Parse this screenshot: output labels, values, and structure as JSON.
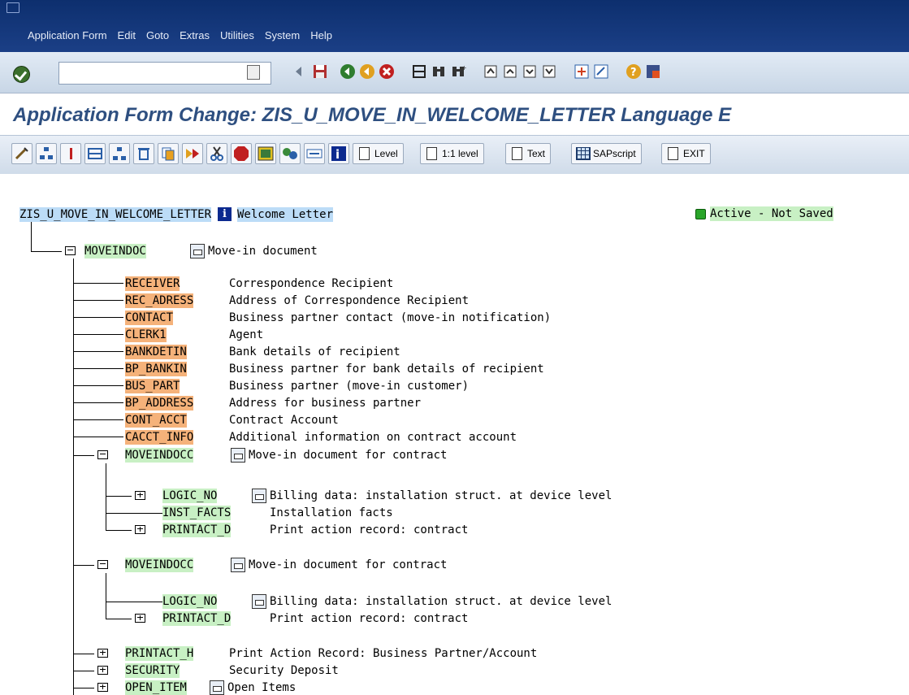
{
  "menu": [
    "Application Form",
    "Edit",
    "Goto",
    "Extras",
    "Utilities",
    "System",
    "Help"
  ],
  "title": "Application Form Change: ZIS_U_MOVE_IN_WELCOME_LETTER Language E",
  "app_toolbar_buttons": {
    "level": "Level",
    "one_to_one_level": "1:1 level",
    "text": "Text",
    "sapscript": "SAPscript",
    "exit": "EXIT"
  },
  "root": {
    "name": "ZIS_U_MOVE_IN_WELCOME_LETTER",
    "desc": "Welcome Letter",
    "status": "Active - Not Saved"
  },
  "tree": {
    "moveindoc": {
      "name": "MOVEINDOC",
      "desc": "Move-in document"
    },
    "leaves": [
      {
        "name": "RECEIVER",
        "desc": "Correspondence Recipient"
      },
      {
        "name": "REC_ADRESS",
        "desc": "Address of Correspondence Recipient"
      },
      {
        "name": "CONTACT",
        "desc": "Business partner contact (move-in notification)"
      },
      {
        "name": "CLERK1",
        "desc": "Agent"
      },
      {
        "name": "BANKDETIN",
        "desc": "Bank details of recipient"
      },
      {
        "name": "BP_BANKIN",
        "desc": "Business partner for bank details of recipient"
      },
      {
        "name": "BUS_PART",
        "desc": "Business partner (move-in customer)"
      },
      {
        "name": "BP_ADDRESS",
        "desc": "Address for business partner"
      },
      {
        "name": "CONT_ACCT",
        "desc": "Contract Account"
      },
      {
        "name": "CACCT_INFO",
        "desc": "Additional information on contract account"
      }
    ],
    "moveindocc1": {
      "name": "MOVEINDOCC",
      "desc": "Move-in document for contract"
    },
    "c1": [
      {
        "name": "LOGIC_NO",
        "desc": "Billing data: installation struct. at device level"
      },
      {
        "name": "INST_FACTS",
        "desc": "Installation facts"
      },
      {
        "name": "PRINTACT_D",
        "desc": "Print action record: contract"
      }
    ],
    "moveindocc2": {
      "name": "MOVEINDOCC",
      "desc": "Move-in document for contract"
    },
    "c2": [
      {
        "name": "LOGIC_NO",
        "desc": "Billing data: installation struct. at device level"
      },
      {
        "name": "PRINTACT_D",
        "desc": "Print action record: contract"
      }
    ],
    "bottom": [
      {
        "name": "PRINTACT_H",
        "desc": "Print Action Record: Business Partner/Account"
      },
      {
        "name": "SECURITY",
        "desc": "Security Deposit"
      },
      {
        "name": "OPEN_ITEM",
        "desc": "Open Items"
      }
    ]
  },
  "colors": {
    "menubar": "#1b3f86",
    "title": "#2e4f80",
    "orange": "#f5b27a",
    "green": "#c8f0c4",
    "blue": "#bcdcf7"
  }
}
